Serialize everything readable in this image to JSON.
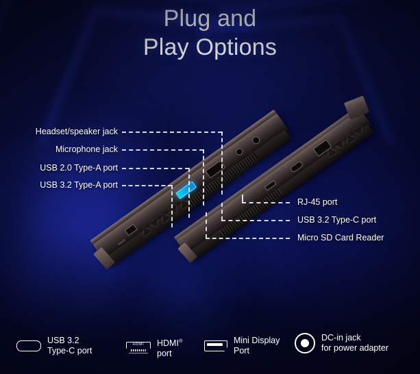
{
  "title": {
    "line1": "Plug and",
    "line2": "Play Options"
  },
  "callouts": {
    "left": [
      {
        "label": "Headset/speaker jack"
      },
      {
        "label": "Microphone jack"
      },
      {
        "label": "USB 2.0 Type-A port"
      },
      {
        "label": "USB 3.2 Type-A port"
      }
    ],
    "right": [
      {
        "label": "RJ-45 port"
      },
      {
        "label": "USB 3.2 Type-C port"
      },
      {
        "label": "Micro SD Card Reader"
      }
    ]
  },
  "legend": {
    "items": [
      {
        "icon": "usb-c-icon",
        "line1": "USB 3.2",
        "line2": "Type-C port"
      },
      {
        "icon": "hdmi-icon",
        "line1": "HDMI",
        "line1_sup": "®",
        "line2": "port"
      },
      {
        "icon": "mini-displayport-icon",
        "line1": "Mini Display",
        "line2": "Port"
      },
      {
        "icon": "dc-in-jack-icon",
        "line1": "DC-in jack",
        "line2": "for power adapter"
      }
    ],
    "hdmi_icon_text": "HDMI"
  },
  "device": {
    "product_badge": "ASUS"
  },
  "colors": {
    "background_deep": "#05061f",
    "background_blue": "#0a0f42",
    "accent_streak": "#2c44dc",
    "text": "#ffffff",
    "leader_line": "#e8eaf6",
    "usb_port_glow": "#0bd0f6",
    "chassis_light": "#6e5f5c",
    "chassis_dark": "#171212"
  }
}
